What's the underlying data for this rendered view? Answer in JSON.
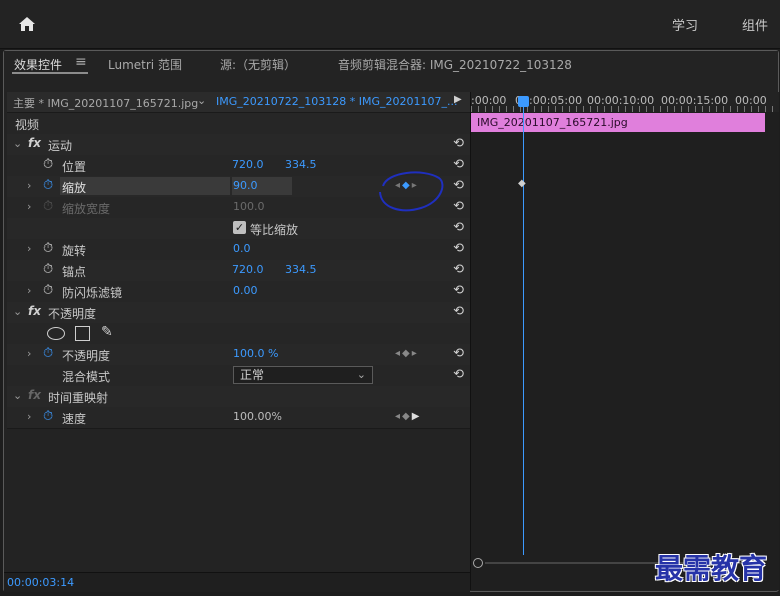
{
  "topbar": {
    "home_icon": "home-icon",
    "menu": [
      "学习",
      "组件"
    ]
  },
  "tabs": [
    {
      "label": "效果控件",
      "active": true
    },
    {
      "label": "Lumetri 范围"
    },
    {
      "label": "源:（无剪辑）"
    },
    {
      "label": "音频剪辑混合器: IMG_20210722_103128"
    }
  ],
  "tab_menu_icon": "≡",
  "clip_header": {
    "master": "主要 * IMG_20201107_165721.jpg",
    "sequence": "IMG_20210722_103128 * IMG_20201107_..."
  },
  "timeline": {
    "ruler": [
      ":00:00",
      "00:00:05:00",
      "00:00:10:00",
      "00:00:15:00",
      "00:00"
    ],
    "clip_label": "IMG_20201107_165721.jpg",
    "clip_color": "#e07fdc"
  },
  "sections": {
    "video": "视频",
    "motion": "运动",
    "opacity_group": "不透明度",
    "time_remap": "时间重映射"
  },
  "props": {
    "position": {
      "label": "位置",
      "x": "720.0",
      "y": "334.5"
    },
    "scale": {
      "label": "缩放",
      "value": "90.0"
    },
    "scale_width": {
      "label": "缩放宽度",
      "value": "100.0"
    },
    "uniform": {
      "label": "等比缩放",
      "checked": true
    },
    "rotation": {
      "label": "旋转",
      "value": "0.0"
    },
    "anchor": {
      "label": "锚点",
      "x": "720.0",
      "y": "334.5"
    },
    "antiflicker": {
      "label": "防闪烁滤镜",
      "value": "0.00"
    },
    "opacity": {
      "label": "不透明度",
      "value": "100.0 %"
    },
    "blend": {
      "label": "混合模式",
      "value": "正常"
    },
    "speed": {
      "label": "速度",
      "value": "100.00%"
    }
  },
  "timecode": "00:00:03:14",
  "watermark": "最需教育",
  "colors": {
    "accent": "#3c9aff",
    "annotation": "#1f2fbf"
  }
}
